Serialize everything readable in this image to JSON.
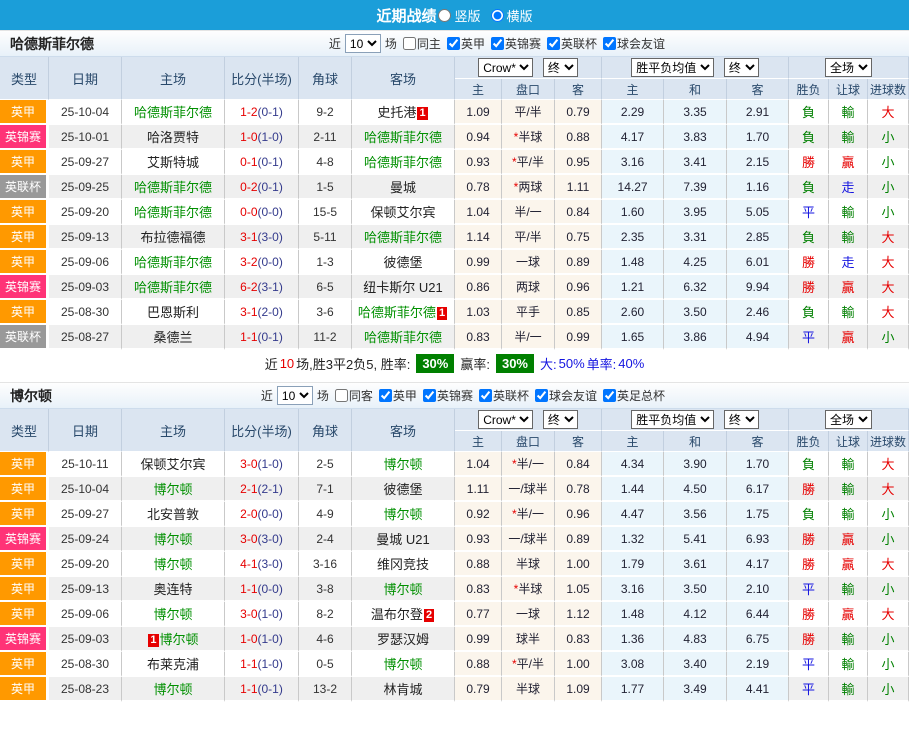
{
  "topbar": {
    "title": "近期战绩",
    "vertical_label": "竖版",
    "horizontal_label": "横版",
    "selected": "横版"
  },
  "columns": {
    "type": "类型",
    "date": "日期",
    "home": "主场",
    "score": "比分(半场)",
    "corner": "角球",
    "away": "客场",
    "odds_home": "主",
    "odds_handicap": "盘口",
    "odds_away": "客",
    "avg_home": "主",
    "avg_draw": "和",
    "avg_away": "客",
    "result_wdl": "胜负",
    "result_handicap": "让球",
    "result_goals": "进球数"
  },
  "dropdowns": {
    "provider": "Crow*",
    "stage1": "终",
    "avg": "胜平负均值",
    "stage2": "终",
    "scope": "全场"
  },
  "league_colors": {
    "英甲": "#ff9900",
    "英锦赛": "#ff3377",
    "英联杯": "#999999"
  },
  "result_colors": {
    "勝": "#e60000",
    "贏": "#e60000",
    "大": "#e60000",
    "負": "#008000",
    "輸": "#008000",
    "小": "#008000",
    "平": "#1414e0",
    "走": "#1414e0"
  },
  "sections": [
    {
      "team": "哈德斯菲尔德",
      "filter": {
        "near_label": "近",
        "games_value": "10",
        "games_label": "场",
        "same_label": "同主",
        "same_checked": false,
        "leagues": [
          {
            "label": "英甲",
            "checked": true
          },
          {
            "label": "英锦赛",
            "checked": true
          },
          {
            "label": "英联杯",
            "checked": true
          },
          {
            "label": "球会友谊",
            "checked": true
          }
        ]
      },
      "rows": [
        {
          "league": "英甲",
          "date": "25-10-04",
          "home": {
            "name": "哈德斯菲尔德",
            "green": true
          },
          "score": {
            "full": "1-2",
            "half": "(0-1)"
          },
          "corners": "9-2",
          "away": {
            "name": "史托港",
            "green": false,
            "badge": "1"
          },
          "odds": [
            "1.09",
            "平/半",
            "0.79"
          ],
          "avg": [
            "2.29",
            "3.35",
            "2.91"
          ],
          "results": [
            "負",
            "輸",
            "大"
          ]
        },
        {
          "league": "英锦赛",
          "date": "25-10-01",
          "home": {
            "name": "哈洛贾特",
            "green": false
          },
          "score": {
            "full": "1-0",
            "half": "(1-0)"
          },
          "corners": "2-11",
          "away": {
            "name": "哈德斯菲尔德",
            "green": true
          },
          "odds": [
            "0.94",
            "*半球",
            "0.88"
          ],
          "avg": [
            "4.17",
            "3.83",
            "1.70"
          ],
          "results": [
            "負",
            "輸",
            "小"
          ]
        },
        {
          "league": "英甲",
          "date": "25-09-27",
          "home": {
            "name": "艾斯特城",
            "green": false
          },
          "score": {
            "full": "0-1",
            "half": "(0-1)"
          },
          "corners": "4-8",
          "away": {
            "name": "哈德斯菲尔德",
            "green": true
          },
          "odds": [
            "0.93",
            "*平/半",
            "0.95"
          ],
          "avg": [
            "3.16",
            "3.41",
            "2.15"
          ],
          "results": [
            "勝",
            "贏",
            "小"
          ]
        },
        {
          "league": "英联杯",
          "date": "25-09-25",
          "home": {
            "name": "哈德斯菲尔德",
            "green": true
          },
          "score": {
            "full": "0-2",
            "half": "(0-1)"
          },
          "corners": "1-5",
          "away": {
            "name": "曼城",
            "green": false
          },
          "odds": [
            "0.78",
            "*两球",
            "1.11"
          ],
          "avg": [
            "14.27",
            "7.39",
            "1.16"
          ],
          "results": [
            "負",
            "走",
            "小"
          ]
        },
        {
          "league": "英甲",
          "date": "25-09-20",
          "home": {
            "name": "哈德斯菲尔德",
            "green": true
          },
          "score": {
            "full": "0-0",
            "half": "(0-0)"
          },
          "corners": "15-5",
          "away": {
            "name": "保顿艾尔宾",
            "green": false
          },
          "odds": [
            "1.04",
            "半/一",
            "0.84"
          ],
          "avg": [
            "1.60",
            "3.95",
            "5.05"
          ],
          "results": [
            "平",
            "輸",
            "小"
          ]
        },
        {
          "league": "英甲",
          "date": "25-09-13",
          "home": {
            "name": "布拉德福德",
            "green": false
          },
          "score": {
            "full": "3-1",
            "half": "(3-0)"
          },
          "corners": "5-11",
          "away": {
            "name": "哈德斯菲尔德",
            "green": true
          },
          "odds": [
            "1.14",
            "平/半",
            "0.75"
          ],
          "avg": [
            "2.35",
            "3.31",
            "2.85"
          ],
          "results": [
            "負",
            "輸",
            "大"
          ]
        },
        {
          "league": "英甲",
          "date": "25-09-06",
          "home": {
            "name": "哈德斯菲尔德",
            "green": true
          },
          "score": {
            "full": "3-2",
            "half": "(0-0)"
          },
          "corners": "1-3",
          "away": {
            "name": "彼德堡",
            "green": false
          },
          "odds": [
            "0.99",
            "一球",
            "0.89"
          ],
          "avg": [
            "1.48",
            "4.25",
            "6.01"
          ],
          "results": [
            "勝",
            "走",
            "大"
          ]
        },
        {
          "league": "英锦赛",
          "date": "25-09-03",
          "home": {
            "name": "哈德斯菲尔德",
            "green": true
          },
          "score": {
            "full": "6-2",
            "half": "(3-1)"
          },
          "corners": "6-5",
          "away": {
            "name": "纽卡斯尔 U21",
            "green": false
          },
          "odds": [
            "0.86",
            "两球",
            "0.96"
          ],
          "avg": [
            "1.21",
            "6.32",
            "9.94"
          ],
          "results": [
            "勝",
            "贏",
            "大"
          ]
        },
        {
          "league": "英甲",
          "date": "25-08-30",
          "home": {
            "name": "巴恩斯利",
            "green": false
          },
          "score": {
            "full": "3-1",
            "half": "(2-0)"
          },
          "corners": "3-6",
          "away": {
            "name": "哈德斯菲尔德",
            "green": true,
            "badge": "1"
          },
          "odds": [
            "1.03",
            "平手",
            "0.85"
          ],
          "avg": [
            "2.60",
            "3.50",
            "2.46"
          ],
          "results": [
            "負",
            "輸",
            "大"
          ]
        },
        {
          "league": "英联杯",
          "date": "25-08-27",
          "home": {
            "name": "桑德兰",
            "green": false
          },
          "score": {
            "full": "1-1",
            "half": "(0-1)"
          },
          "corners": "11-2",
          "away": {
            "name": "哈德斯菲尔德",
            "green": true
          },
          "odds": [
            "0.83",
            "半/一",
            "0.99"
          ],
          "avg": [
            "1.65",
            "3.86",
            "4.94"
          ],
          "results": [
            "平",
            "贏",
            "小"
          ]
        }
      ],
      "summary": {
        "parts": [
          {
            "t": "近",
            "s": "k"
          },
          {
            "t": "10",
            "s": "r"
          },
          {
            "t": "场,胜3平2负5, 胜率:",
            "s": "k"
          },
          {
            "t": "30%",
            "s": "g"
          },
          {
            "t": "赢率:",
            "s": "k"
          },
          {
            "t": "30%",
            "s": "g"
          },
          {
            "t": "大:",
            "s": "b"
          },
          {
            "t": "50%",
            "s": "b"
          },
          {
            "t": "单率:",
            "s": "b"
          },
          {
            "t": "40%",
            "s": "b"
          }
        ]
      }
    },
    {
      "team": "博尔顿",
      "filter": {
        "near_label": "近",
        "games_value": "10",
        "games_label": "场",
        "same_label": "同客",
        "same_checked": false,
        "leagues": [
          {
            "label": "英甲",
            "checked": true
          },
          {
            "label": "英锦赛",
            "checked": true
          },
          {
            "label": "英联杯",
            "checked": true
          },
          {
            "label": "球会友谊",
            "checked": true
          },
          {
            "label": "英足总杯",
            "checked": true
          }
        ]
      },
      "rows": [
        {
          "league": "英甲",
          "date": "25-10-11",
          "home": {
            "name": "保顿艾尔宾",
            "green": false
          },
          "score": {
            "full": "3-0",
            "half": "(1-0)"
          },
          "corners": "2-5",
          "away": {
            "name": "博尔顿",
            "green": true
          },
          "odds": [
            "1.04",
            "*半/一",
            "0.84"
          ],
          "avg": [
            "4.34",
            "3.90",
            "1.70"
          ],
          "results": [
            "負",
            "輸",
            "大"
          ]
        },
        {
          "league": "英甲",
          "date": "25-10-04",
          "home": {
            "name": "博尔顿",
            "green": true
          },
          "score": {
            "full": "2-1",
            "half": "(2-1)"
          },
          "corners": "7-1",
          "away": {
            "name": "彼德堡",
            "green": false
          },
          "odds": [
            "1.11",
            "一/球半",
            "0.78"
          ],
          "avg": [
            "1.44",
            "4.50",
            "6.17"
          ],
          "results": [
            "勝",
            "輸",
            "大"
          ]
        },
        {
          "league": "英甲",
          "date": "25-09-27",
          "home": {
            "name": "北安普敦",
            "green": false
          },
          "score": {
            "full": "2-0",
            "half": "(0-0)"
          },
          "corners": "4-9",
          "away": {
            "name": "博尔顿",
            "green": true
          },
          "odds": [
            "0.92",
            "*半/一",
            "0.96"
          ],
          "avg": [
            "4.47",
            "3.56",
            "1.75"
          ],
          "results": [
            "負",
            "輸",
            "小"
          ]
        },
        {
          "league": "英锦赛",
          "date": "25-09-24",
          "home": {
            "name": "博尔顿",
            "green": true
          },
          "score": {
            "full": "3-0",
            "half": "(3-0)"
          },
          "corners": "2-4",
          "away": {
            "name": "曼城 U21",
            "green": false
          },
          "odds": [
            "0.93",
            "一/球半",
            "0.89"
          ],
          "avg": [
            "1.32",
            "5.41",
            "6.93"
          ],
          "results": [
            "勝",
            "贏",
            "小"
          ]
        },
        {
          "league": "英甲",
          "date": "25-09-20",
          "home": {
            "name": "博尔顿",
            "green": true
          },
          "score": {
            "full": "4-1",
            "half": "(3-0)"
          },
          "corners": "3-16",
          "away": {
            "name": "维冈竞技",
            "green": false
          },
          "odds": [
            "0.88",
            "半球",
            "1.00"
          ],
          "avg": [
            "1.79",
            "3.61",
            "4.17"
          ],
          "results": [
            "勝",
            "贏",
            "大"
          ]
        },
        {
          "league": "英甲",
          "date": "25-09-13",
          "home": {
            "name": "奥连特",
            "green": false
          },
          "score": {
            "full": "1-1",
            "half": "(0-0)"
          },
          "corners": "3-8",
          "away": {
            "name": "博尔顿",
            "green": true
          },
          "odds": [
            "0.83",
            "*半球",
            "1.05"
          ],
          "avg": [
            "3.16",
            "3.50",
            "2.10"
          ],
          "results": [
            "平",
            "輸",
            "小"
          ]
        },
        {
          "league": "英甲",
          "date": "25-09-06",
          "home": {
            "name": "博尔顿",
            "green": true
          },
          "score": {
            "full": "3-0",
            "half": "(1-0)"
          },
          "corners": "8-2",
          "away": {
            "name": "温布尔登",
            "green": false,
            "badge": "2"
          },
          "odds": [
            "0.77",
            "一球",
            "1.12"
          ],
          "avg": [
            "1.48",
            "4.12",
            "6.44"
          ],
          "results": [
            "勝",
            "贏",
            "大"
          ]
        },
        {
          "league": "英锦赛",
          "date": "25-09-03",
          "home": {
            "name": "博尔顿",
            "green": true,
            "badge": "1",
            "badge_pos": "before"
          },
          "score": {
            "full": "1-0",
            "half": "(1-0)"
          },
          "corners": "4-6",
          "away": {
            "name": "罗瑟汉姆",
            "green": false
          },
          "odds": [
            "0.99",
            "球半",
            "0.83"
          ],
          "avg": [
            "1.36",
            "4.83",
            "6.75"
          ],
          "results": [
            "勝",
            "輸",
            "小"
          ]
        },
        {
          "league": "英甲",
          "date": "25-08-30",
          "home": {
            "name": "布莱克浦",
            "green": false
          },
          "score": {
            "full": "1-1",
            "half": "(1-0)"
          },
          "corners": "0-5",
          "away": {
            "name": "博尔顿",
            "green": true
          },
          "odds": [
            "0.88",
            "*平/半",
            "1.00"
          ],
          "avg": [
            "3.08",
            "3.40",
            "2.19"
          ],
          "results": [
            "平",
            "輸",
            "小"
          ]
        },
        {
          "league": "英甲",
          "date": "25-08-23",
          "home": {
            "name": "博尔顿",
            "green": true
          },
          "score": {
            "full": "1-1",
            "half": "(0-1)"
          },
          "corners": "13-2",
          "away": {
            "name": "林肯城",
            "green": false
          },
          "odds": [
            "0.79",
            "半球",
            "1.09"
          ],
          "avg": [
            "1.77",
            "3.49",
            "4.41"
          ],
          "results": [
            "平",
            "輸",
            "小"
          ]
        }
      ],
      "summary": null
    }
  ]
}
